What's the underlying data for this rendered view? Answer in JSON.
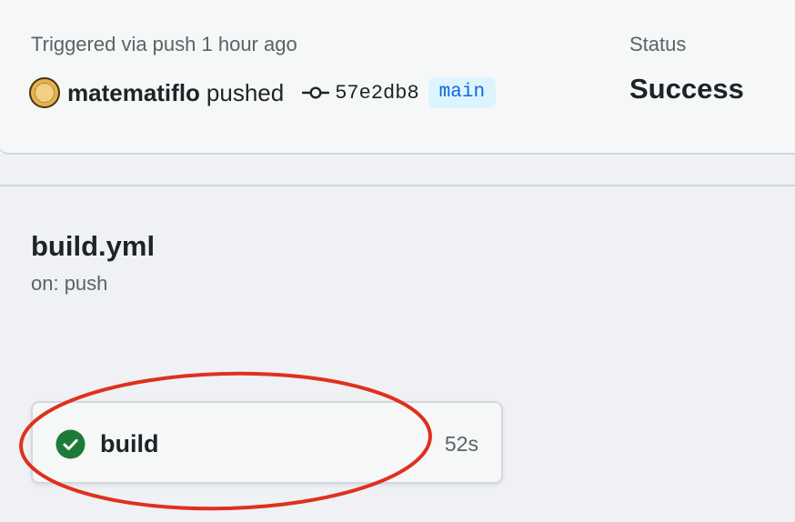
{
  "summary": {
    "trigger_text": "Triggered via push 1 hour ago",
    "actor_name": "matematiflo",
    "actor_action": "pushed",
    "commit_sha": "57e2db8",
    "branch": "main",
    "status_label": "Status",
    "status_value": "Success"
  },
  "workflow": {
    "title": "build.yml",
    "trigger": "on: push"
  },
  "jobs": [
    {
      "name": "build",
      "duration": "52s",
      "status": "success",
      "status_icon": "check-circle-icon"
    }
  ],
  "colors": {
    "success": "#1f7a3a",
    "branch_text": "#0969da",
    "branch_bg": "#ddf4ff",
    "annotation": "#e0301e"
  }
}
